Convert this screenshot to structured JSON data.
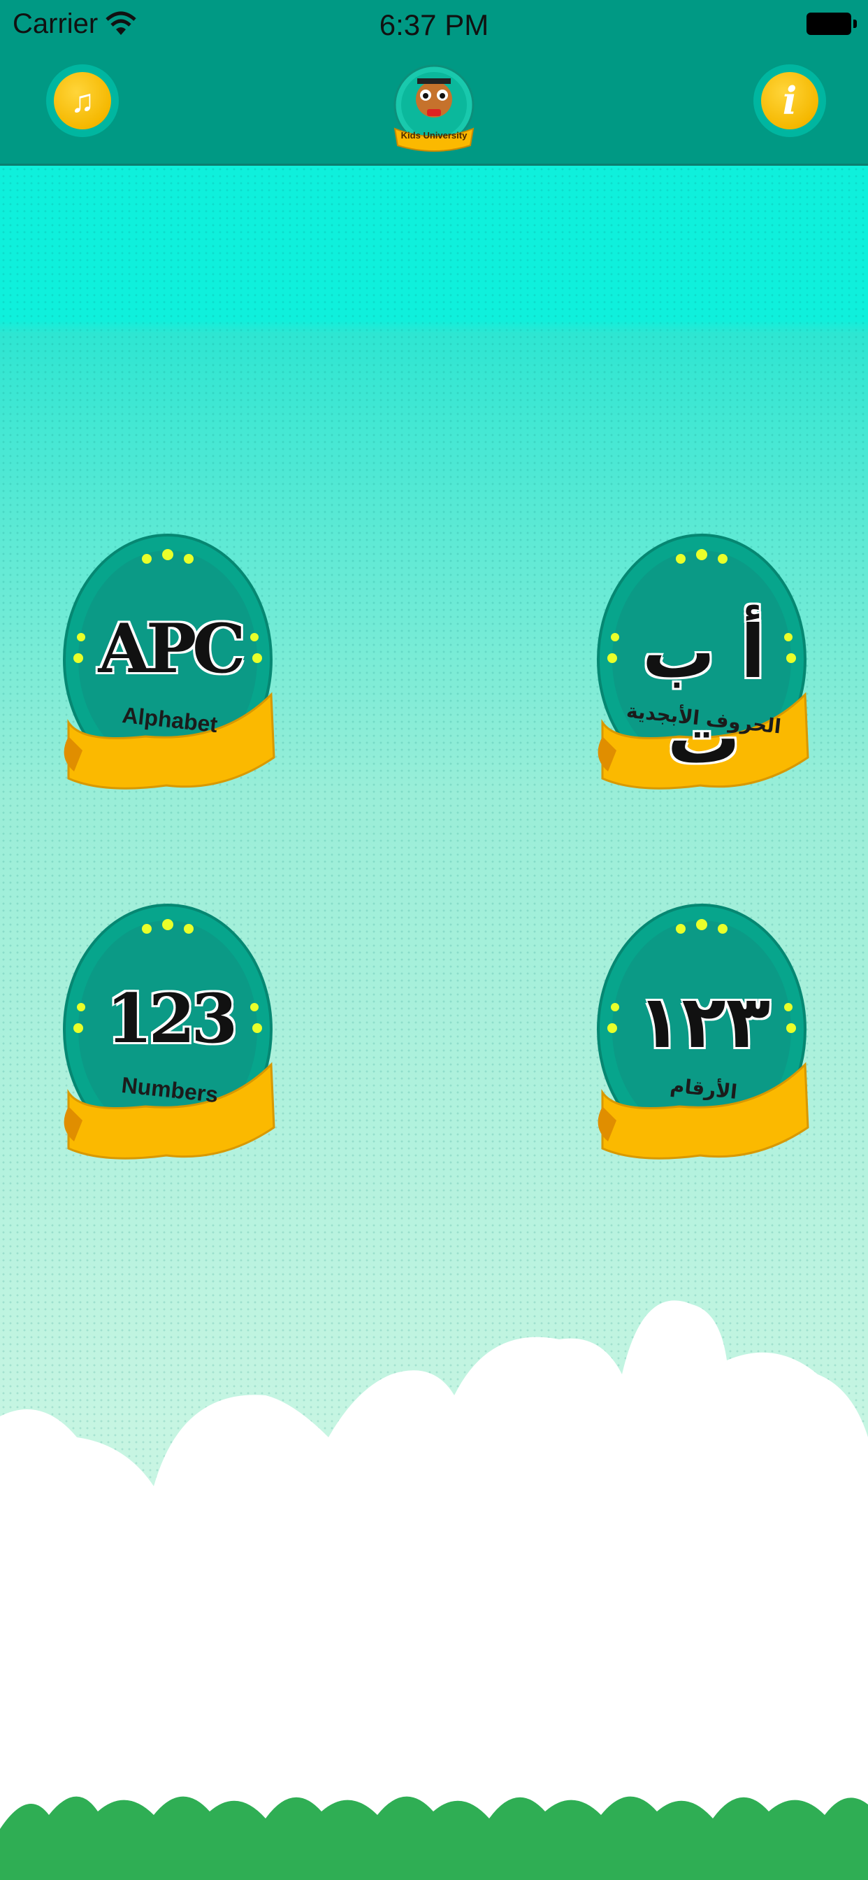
{
  "status_bar": {
    "carrier": "Carrier",
    "time": "6:37 PM"
  },
  "header": {
    "music_icon": "music-note-icon",
    "info_icon": "info-icon",
    "info_glyph": "i",
    "music_glyph": "♫",
    "logo_text": "Kids University"
  },
  "menu": {
    "items": [
      {
        "label": "Alphabet",
        "art": "APC"
      },
      {
        "label": "الحروف الأبجدية",
        "art": "أ ب ت"
      },
      {
        "label": "Numbers",
        "art": "123"
      },
      {
        "label": "الأرقام",
        "art": "١٢٣"
      }
    ]
  },
  "colors": {
    "header": "#009984",
    "badge_teal": "#00a98f",
    "ribbon": "#fbb900",
    "content_top": "#0ff0dc",
    "content_bottom": "#d6f7ea",
    "grass": "#2fae54"
  }
}
